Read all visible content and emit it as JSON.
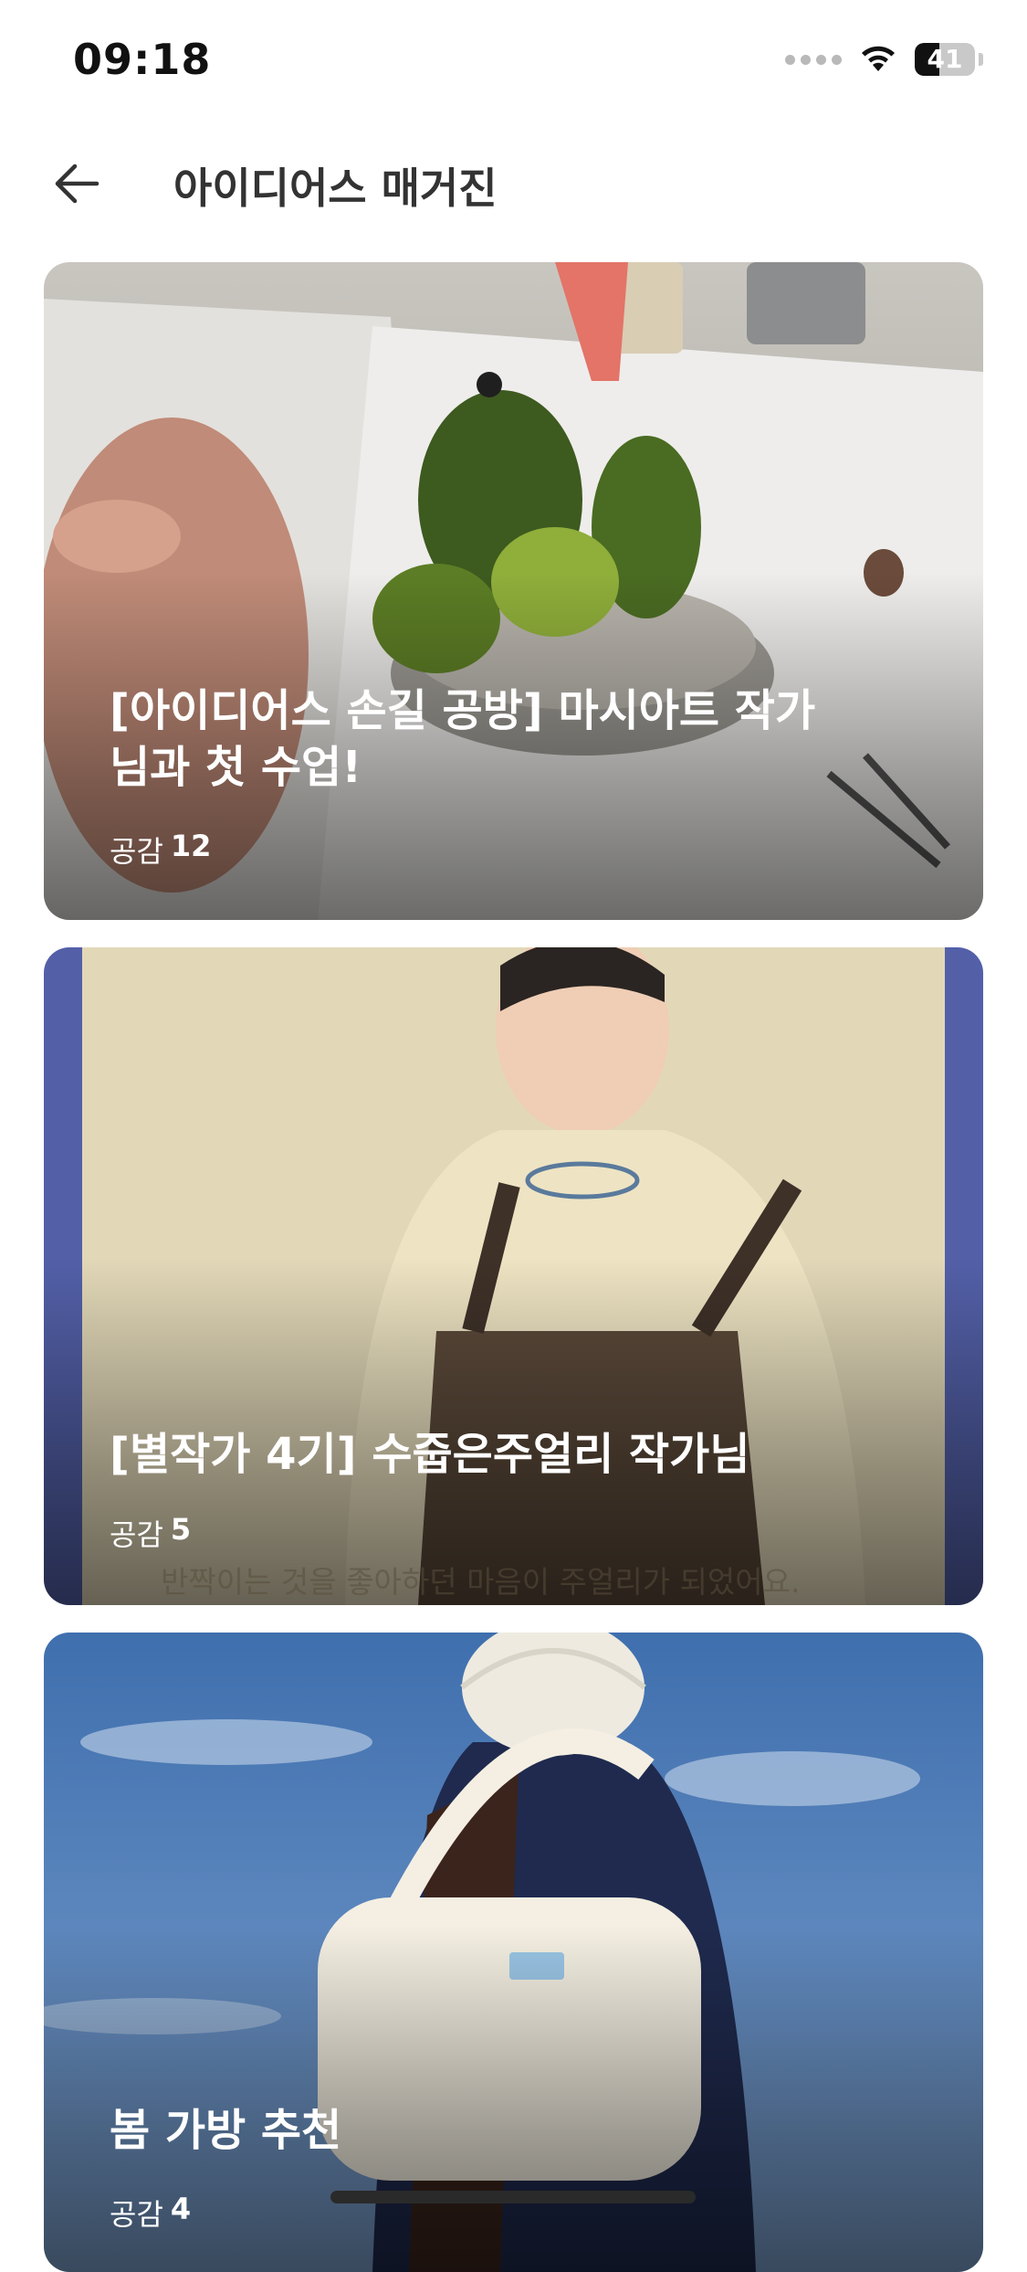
{
  "status_bar": {
    "time": "09:18",
    "battery": "41",
    "battery_level": 0.41,
    "icons": [
      "signal-dots-icon",
      "wifi-icon",
      "battery-icon"
    ]
  },
  "header": {
    "title": "아이디어스 매거진",
    "back_icon": "arrow-left-icon"
  },
  "articles": [
    {
      "title": "[아이디어스 손길 공방] 마시아트 작가님과 첫 수업!",
      "likes_label": "공감",
      "likes_count": "12"
    },
    {
      "title": "[별작가 4기] 수줍은주얼리 작가님",
      "likes_label": "공감",
      "likes_count": "5",
      "image_caption": "반짝이는 것을 좋아하던 마음이 주얼리가 되었어요."
    },
    {
      "title": "봄 가방 추천",
      "likes_label": "공감",
      "likes_count": "4"
    }
  ],
  "colors": {
    "title_text": "#333333",
    "card_text": "#ffffff",
    "card2_side": "#5360a8",
    "sky": "#4f79b8"
  }
}
